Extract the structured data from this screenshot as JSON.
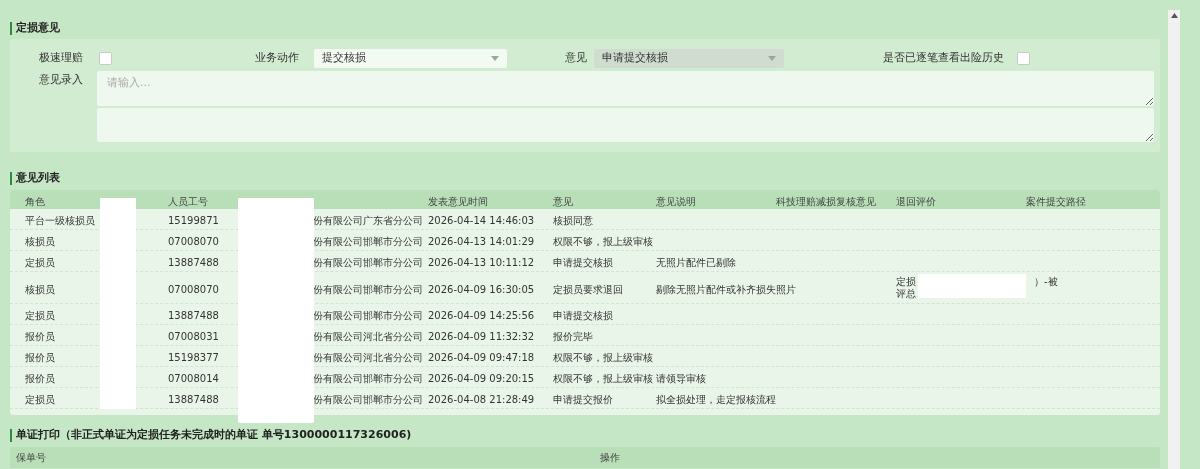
{
  "opinion_section": {
    "title": "定损意见",
    "fast_claim": {
      "label": "极速理赔",
      "checked": false
    },
    "business_action": {
      "label": "业务动作",
      "value": "提交核损",
      "disabled": false
    },
    "opinion": {
      "label": "意见",
      "value": "申请提交核损",
      "disabled": true
    },
    "history_checked": {
      "label": "是否已逐笔查看出险历史",
      "checked": false
    },
    "opinion_input": {
      "label": "意见录入",
      "placeholder": "请输入..."
    }
  },
  "list_section": {
    "title": "意见列表",
    "columns": [
      "角色",
      "人员工号",
      "发表意见时间",
      "意见",
      "意见说明",
      "科技理赔减损复核意见",
      "退回评价",
      "案件提交路径"
    ],
    "rows": [
      {
        "role": "平台一级核损员",
        "staff_id": "15199871",
        "org": "份有限公司广东省分公司",
        "time": "2026-04-14 14:46:03",
        "opinion": "核损同意",
        "note": "",
        "return_eval": []
      },
      {
        "role": "核损员",
        "staff_id": "07008070",
        "org": "份有限公司邯郸市分公司",
        "time": "2026-04-13 14:01:29",
        "opinion": "权限不够，报上级审核",
        "note": "",
        "return_eval": []
      },
      {
        "role": "定损员",
        "staff_id": "13887488",
        "org": "份有限公司邯郸市分公司",
        "time": "2026-04-13 10:11:12",
        "opinion": "申请提交核损",
        "note": "无照片配件已剔除",
        "return_eval": []
      },
      {
        "role": "核损员",
        "staff_id": "07008070",
        "org": "份有限公司邯郸市分公司",
        "time": "2026-04-09 16:30:05",
        "opinion": "定损员要求退回",
        "note": "剔除无照片配件或补齐损失照片",
        "return_eval": [
          "定损",
          "）-被",
          "评总"
        ]
      },
      {
        "role": "定损员",
        "staff_id": "13887488",
        "org": "份有限公司邯郸市分公司",
        "time": "2026-04-09 14:25:56",
        "opinion": "申请提交核损",
        "note": "",
        "return_eval": []
      },
      {
        "role": "报价员",
        "staff_id": "07008031",
        "org": "份有限公司河北省分公司",
        "time": "2026-04-09 11:32:32",
        "opinion": "报价完毕",
        "note": "",
        "return_eval": []
      },
      {
        "role": "报价员",
        "staff_id": "15198377",
        "org": "份有限公司河北省分公司",
        "time": "2026-04-09 09:47:18",
        "opinion": "权限不够，报上级审核",
        "note": "",
        "return_eval": []
      },
      {
        "role": "报价员",
        "staff_id": "07008014",
        "org": "份有限公司邯郸市分公司",
        "time": "2026-04-09 09:20:15",
        "opinion": "权限不够，报上级审核",
        "note": "请领导审核",
        "return_eval": []
      },
      {
        "role": "定损员",
        "staff_id": "13887488",
        "org": "份有限公司邯郸市分公司",
        "time": "2026-04-08 21:28:49",
        "opinion": "申请提交报价",
        "note": "拟全损处理，走定报核流程",
        "return_eval": []
      }
    ]
  },
  "print_section": {
    "title": "单证打印（非正式单证为定损任务未完成时的单证 单号1300000117326006)",
    "columns": [
      "保单号",
      "操作"
    ]
  }
}
